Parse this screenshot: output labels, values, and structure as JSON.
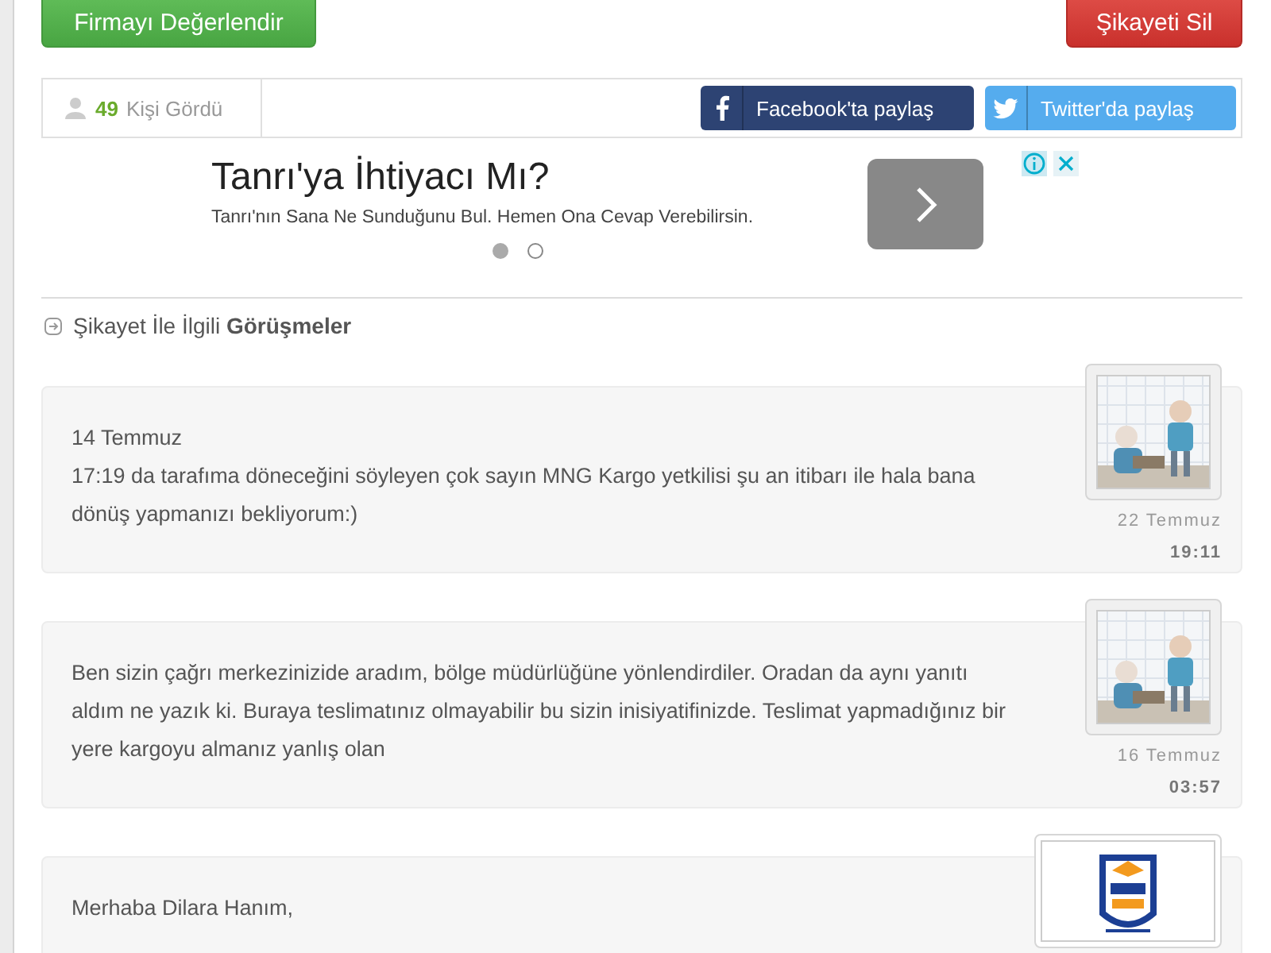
{
  "actions": {
    "rate_button": "Firmayı Değerlendir",
    "delete_button": "Şikayeti Sil"
  },
  "stats": {
    "views": "49",
    "views_label": "Kişi Gördü"
  },
  "share_buttons": [
    {
      "kind": "facebook",
      "label": "Facebook'ta paylaş"
    },
    {
      "kind": "twitter",
      "label": "Twitter'da paylaş"
    }
  ],
  "ad": {
    "title": "Tanrı'ya İhtiyacı Mı?",
    "text": "Tanrı'nın Sana Ne Sunduğunu Bul. Hemen Ona Cevap Verebilirsin.",
    "slides": [
      {
        "selected": true
      },
      {
        "selected": false
      }
    ]
  },
  "section_title": "Şikayet İle İlgili **Görüşmeler**",
  "messages": [
    {
      "lines": [
        "14 Temmuz",
        "17:19 da tarafıma döneceğini söyleyen çok sayın MNG Kargo yetkilisi şu an itibarı ile hala bana dönüş yapmanızı bekliyorum:)"
      ],
      "date": "22 Temmuz",
      "time": "19:11"
    },
    {
      "lines": [
        "Ben sizin çağrı merkezinizide aradım, bölge müdürlüğüne yönlendirdiler. Oradan da aynı yanıtı aldım ne yazık ki. Buraya teslimatınız olmayabilir bu sizin inisiyatifinizde. Teslimat yapmadığınız bir yere kargoyu almanız yanlış olan"
      ],
      "date": "16 Temmuz",
      "time": "03:57"
    },
    {
      "kind": "logo",
      "lines": [
        "Merhaba Dilara Hanım,"
      ]
    }
  ]
}
